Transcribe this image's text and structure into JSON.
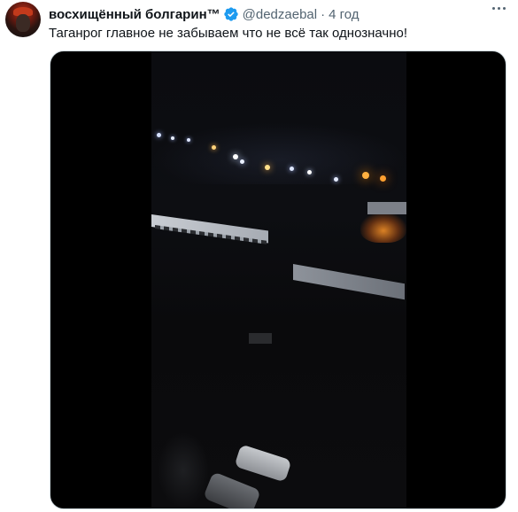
{
  "tweet": {
    "display_name": "восхищённый болгарин™",
    "handle": "@dedzaebal",
    "separator": "·",
    "time": "4 год",
    "text": "Таганрог главное не забываем что не всё так однозначно!",
    "icons": {
      "verified": "verified-badge-icon",
      "more": "more-options-icon"
    }
  },
  "colors": {
    "text_primary": "#0f1419",
    "text_secondary": "#536471",
    "verified_blue": "#1d9bf0",
    "media_border": "#cfd9de",
    "media_background": "#000000"
  }
}
